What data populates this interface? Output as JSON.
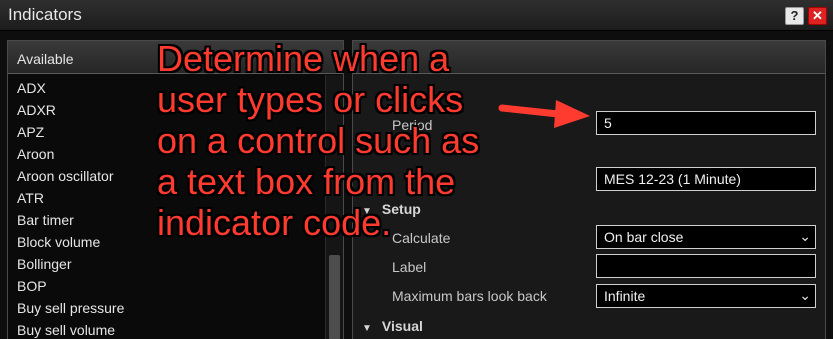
{
  "window": {
    "title": "Indicators",
    "help_label": "?",
    "close_label": "✕"
  },
  "available": {
    "header": "Available",
    "items": [
      "ADX",
      "ADXR",
      "APZ",
      "Aroon",
      "Aroon oscillator",
      "ATR",
      "Bar timer",
      "Block volume",
      "Bollinger",
      "BOP",
      "Buy sell pressure",
      "Buy sell volume"
    ]
  },
  "properties": {
    "period_label": "Period",
    "period_value": "5",
    "input_series_value": "MES 12-23 (1 Minute)",
    "setup_section": "Setup",
    "calculate_label": "Calculate",
    "calculate_value": "On bar close",
    "label_label": "Label",
    "label_value": "",
    "max_bars_label": "Maximum bars look back",
    "max_bars_value": "Infinite",
    "visual_section": "Visual"
  },
  "annotation": {
    "text": "Determine when a\nuser types or clicks\non a control such as\na text box from the\nindicator code.",
    "color": "#ff3b30"
  },
  "icons": [
    "help-icon",
    "close-icon",
    "chevron-down-icon",
    "triangle-down-icon",
    "arrow-icon"
  ]
}
